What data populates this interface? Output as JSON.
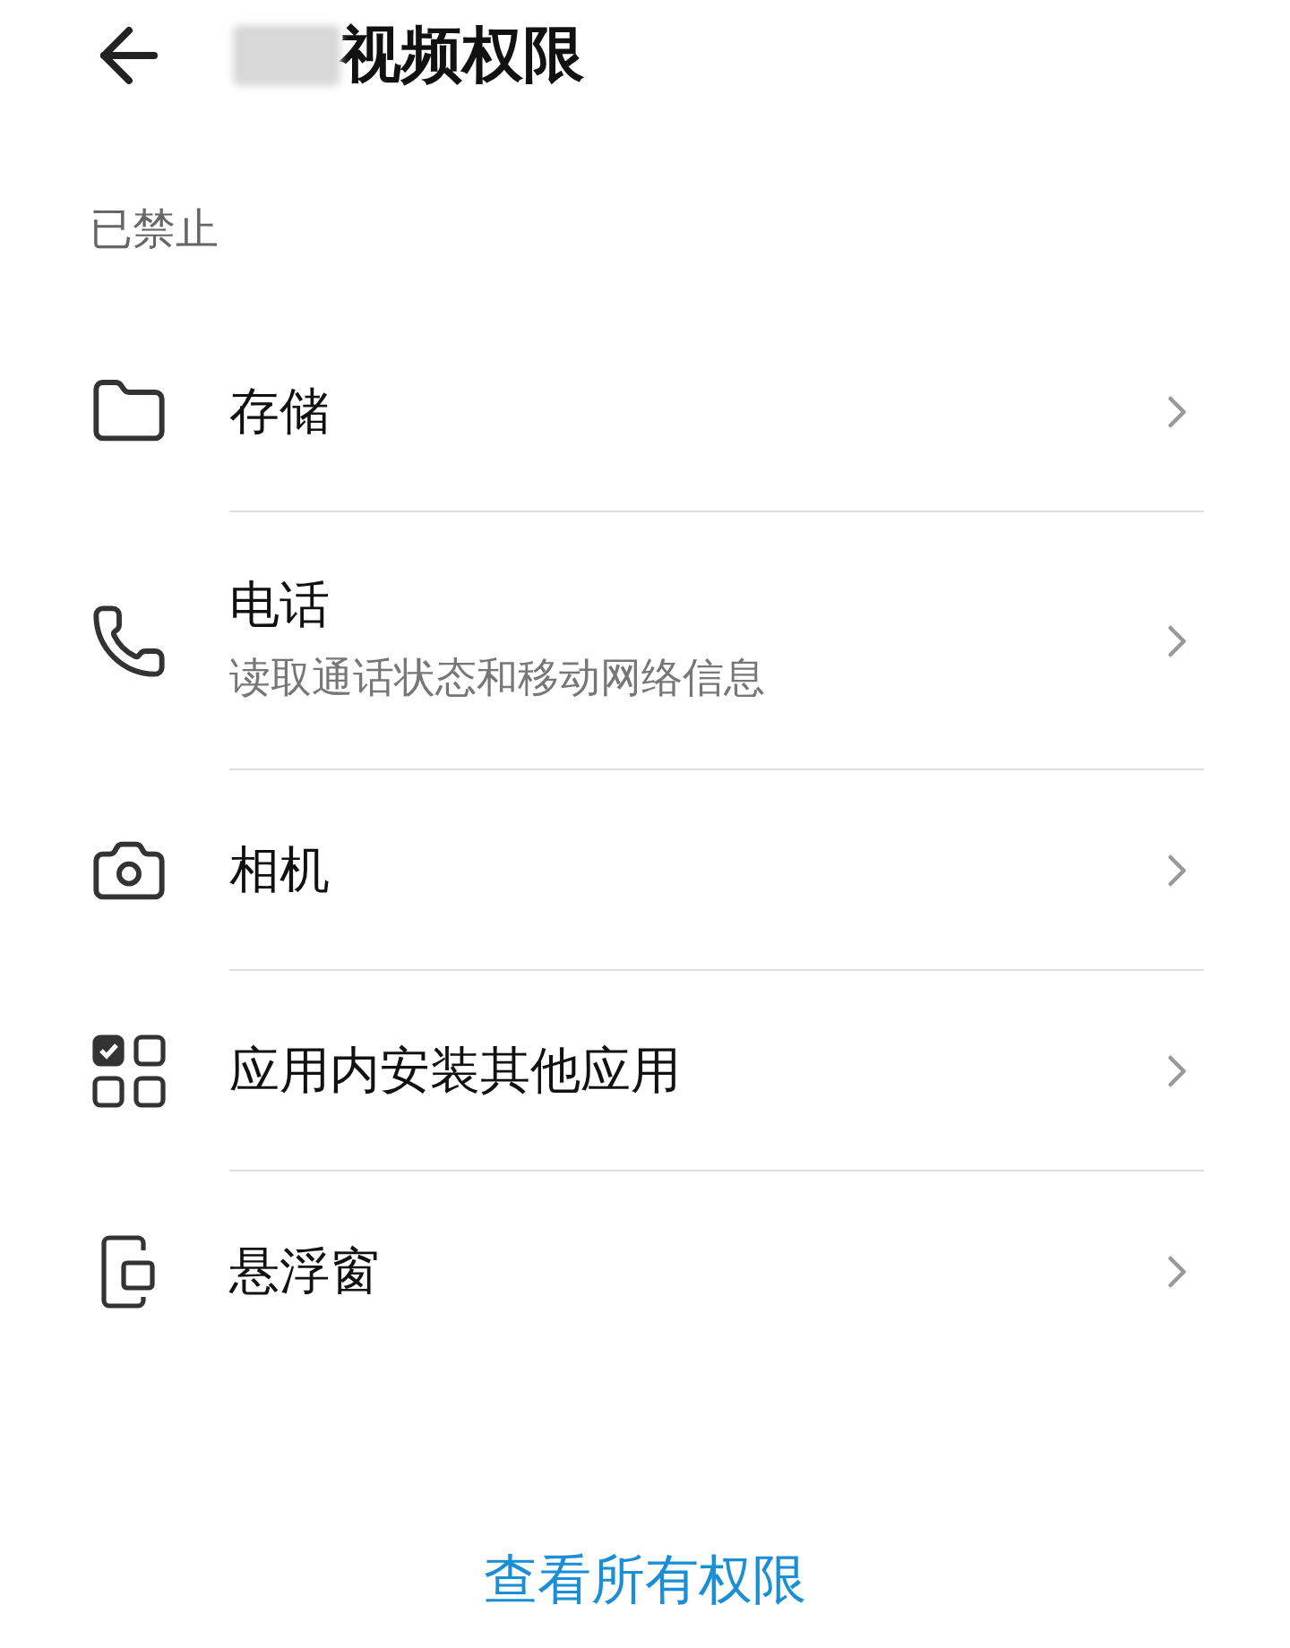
{
  "header": {
    "title": "视频权限"
  },
  "section": {
    "label": "已禁止"
  },
  "permissions": [
    {
      "kind": "storage",
      "title": "存储"
    },
    {
      "kind": "call",
      "title": "电话",
      "subtitle": "读取通话状态和移动网络信息"
    },
    {
      "kind": "capture",
      "title": "相机"
    },
    {
      "kind": "install",
      "title": "应用内安装其他应用"
    },
    {
      "kind": "overlay",
      "title": "悬浮窗"
    }
  ],
  "footer_link": "查看所有权限"
}
